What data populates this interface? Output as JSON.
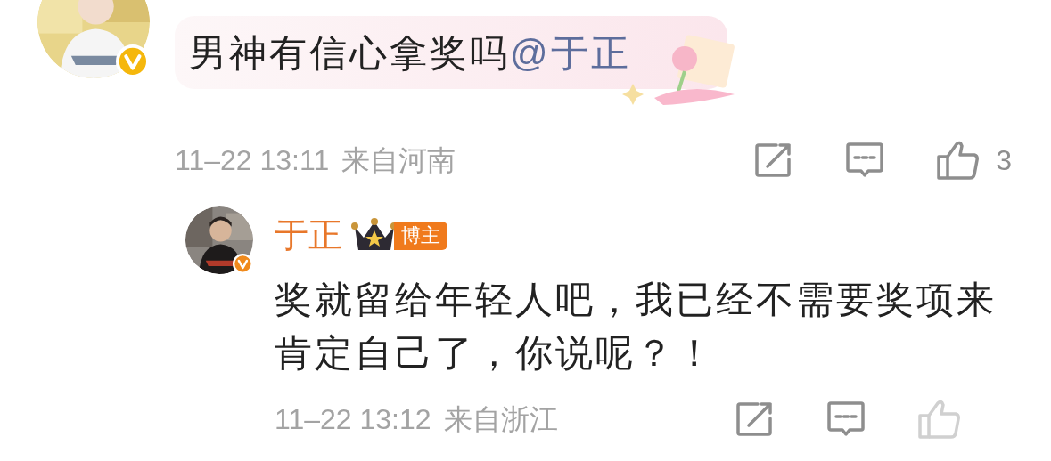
{
  "comment": {
    "verified": true,
    "text": "男神有信心拿奖吗",
    "mention": "@于正",
    "time": "11–22 13:11",
    "location": "来自河南",
    "likes": "3"
  },
  "reply": {
    "verified": true,
    "name": "于正",
    "badge": "博主",
    "text": "奖就留给年轻人吧，我已经不需要奖项来肯定自己了，你说呢？！",
    "time": "11–22 13:12",
    "location": "来自浙江"
  }
}
